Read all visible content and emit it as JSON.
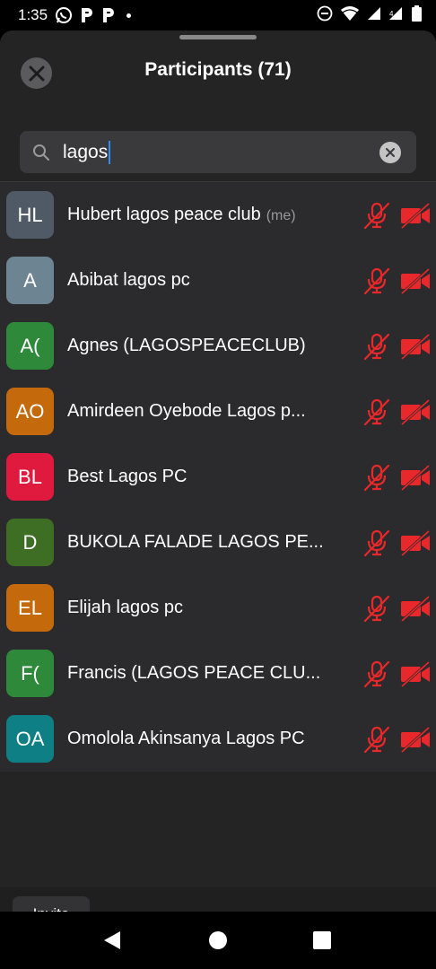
{
  "status_bar": {
    "time": "1:35",
    "notification_icons": [
      "whatsapp-icon",
      "p-app-icon",
      "p-app-icon",
      "dot-icon"
    ],
    "system_icons": [
      "do-not-disturb-icon",
      "wifi-icon",
      "signal-icon",
      "signal-icon",
      "battery-icon"
    ]
  },
  "header": {
    "title": "Participants (71)"
  },
  "search": {
    "value": "lagos"
  },
  "participants": [
    {
      "initials": "HL",
      "color": "#4f5a66",
      "name": "Hubert lagos peace club",
      "tag": "(me)"
    },
    {
      "initials": "A",
      "color": "#6d8492",
      "name": "Abibat lagos pc",
      "tag": ""
    },
    {
      "initials": "A(",
      "color": "#2e8a3a",
      "name": "Agnes (LAGOSPEACECLUB)",
      "tag": ""
    },
    {
      "initials": "AO",
      "color": "#c46a0c",
      "name": "Amirdeen Oyebode Lagos p...",
      "tag": ""
    },
    {
      "initials": "BL",
      "color": "#e0193f",
      "name": "Best Lagos PC",
      "tag": ""
    },
    {
      "initials": "D",
      "color": "#3e6e24",
      "name": "BUKOLA FALADE LAGOS PE...",
      "tag": ""
    },
    {
      "initials": "EL",
      "color": "#c46a0c",
      "name": "Elijah lagos pc",
      "tag": ""
    },
    {
      "initials": "F(",
      "color": "#2e8a3a",
      "name": "Francis (LAGOS PEACE CLU...",
      "tag": ""
    },
    {
      "initials": "OA",
      "color": "#0f7f86",
      "name": "Omolola Akinsanya Lagos PC",
      "tag": ""
    }
  ],
  "colors": {
    "muted_red": "#e8282a",
    "accent_blue": "#2d8cff"
  },
  "footer": {
    "invite_label": "Invite"
  }
}
